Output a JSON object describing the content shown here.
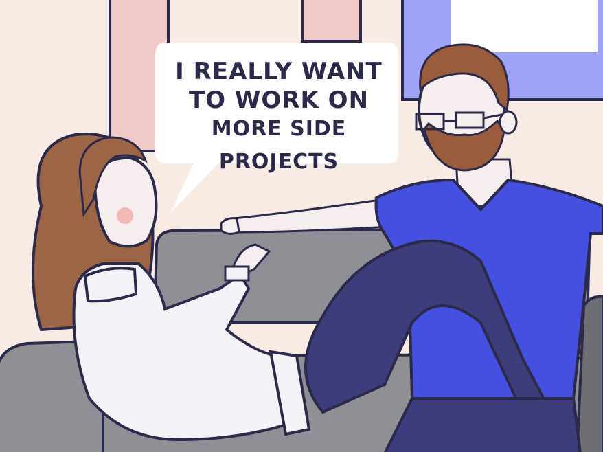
{
  "speech_bubble": {
    "line1": "I REALLY WANT",
    "line2": "TO WORK ON",
    "line3": "MORE SIDE PROJECTS"
  },
  "colors": {
    "wall": "#f7ebe4",
    "left_frame_pink": "#efcac7",
    "right_frame_blue": "#9fa3f6",
    "outline": "#2c2a4a",
    "couch": "#8f9095",
    "couch_dark": "#6e6f74",
    "woman_hair": "#9b6546",
    "sweater": "#f4f2f7",
    "man_shirt": "#4650e0",
    "man_pants": "#3c3d7a",
    "man_beard": "#9b5c3d",
    "skin": "#f6eeee",
    "blush": "#f1b8b6"
  },
  "icons": {
    "left_frame": "picture-frame-icon",
    "right_frame": "picture-frame-icon"
  }
}
